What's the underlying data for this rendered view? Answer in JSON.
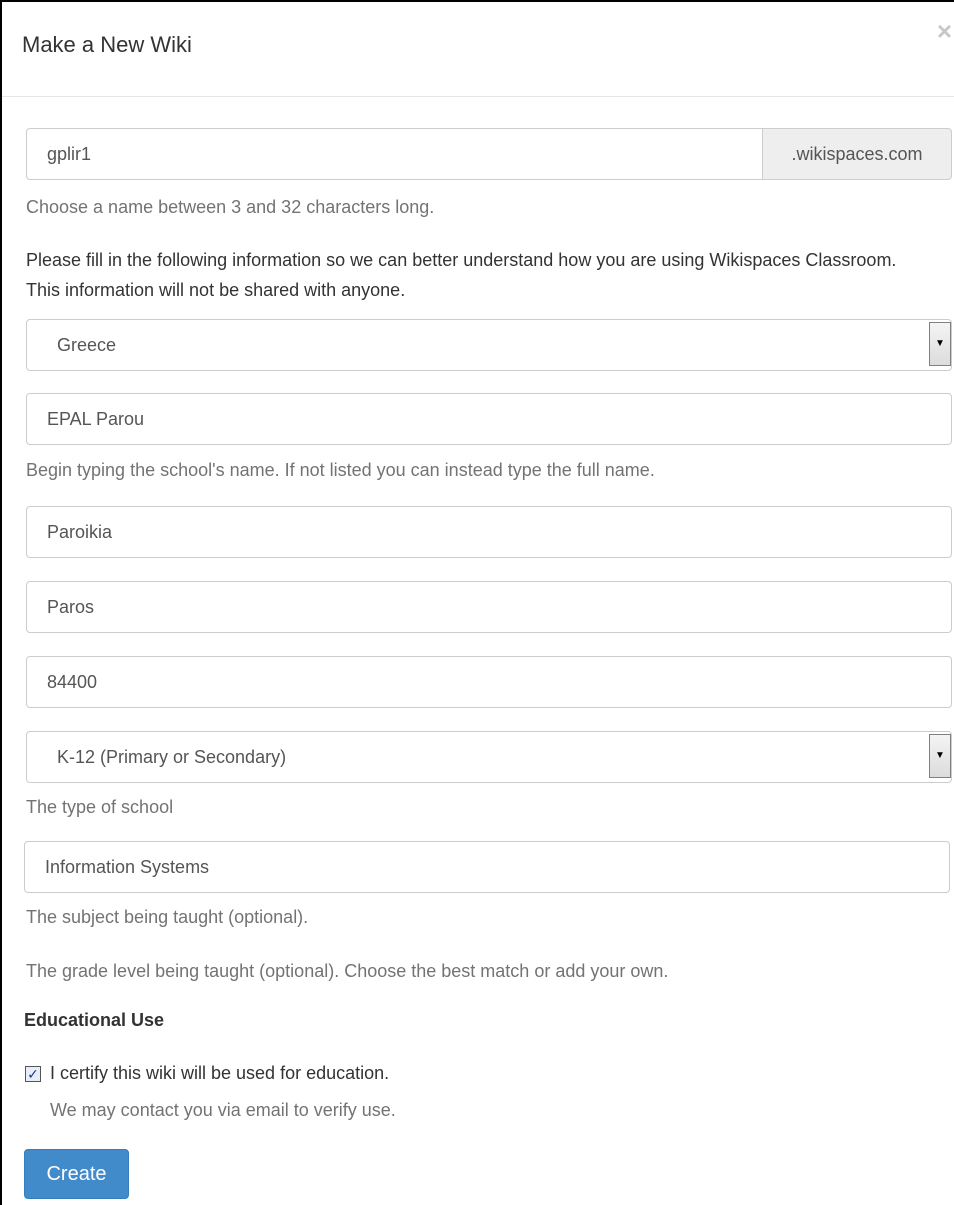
{
  "modal": {
    "title": "Make a New Wiki",
    "close_symbol": "×"
  },
  "form": {
    "wiki_name": {
      "value": "gplir1",
      "suffix": ".wikispaces.com",
      "help": "Choose a name between 3 and 32 characters long."
    },
    "info_text": "Please fill in the following information so we can better understand how you are using Wikispaces Classroom. This information will not be shared with anyone.",
    "country": {
      "selected": "Greece"
    },
    "school_name": {
      "value": "EPAL Parou",
      "help": "Begin typing the school's name. If not listed you can instead type the full name."
    },
    "city": {
      "value": "Paroikia"
    },
    "region": {
      "value": "Paros"
    },
    "postal_code": {
      "value": "84400"
    },
    "school_type": {
      "selected": "K-12 (Primary or Secondary)",
      "help": "The type of school"
    },
    "subject": {
      "value": "Information Systems",
      "help": "The subject being taught (optional)."
    },
    "grade_level": {
      "help": "The grade level being taught (optional). Choose the best match or add your own."
    },
    "educational_use": {
      "heading": "Educational Use",
      "certify_label": "I certify this wiki will be used for education.",
      "certify_checked": true,
      "certify_help": "We may contact you via email to verify use."
    },
    "create_button": "Create"
  },
  "colors": {
    "primary": "#428bca",
    "help_text": "#737373",
    "border": "#cccccc"
  },
  "icons": {
    "close": "close-icon",
    "dropdown": "chevron-down-icon",
    "checkbox": "checkmark-icon"
  }
}
